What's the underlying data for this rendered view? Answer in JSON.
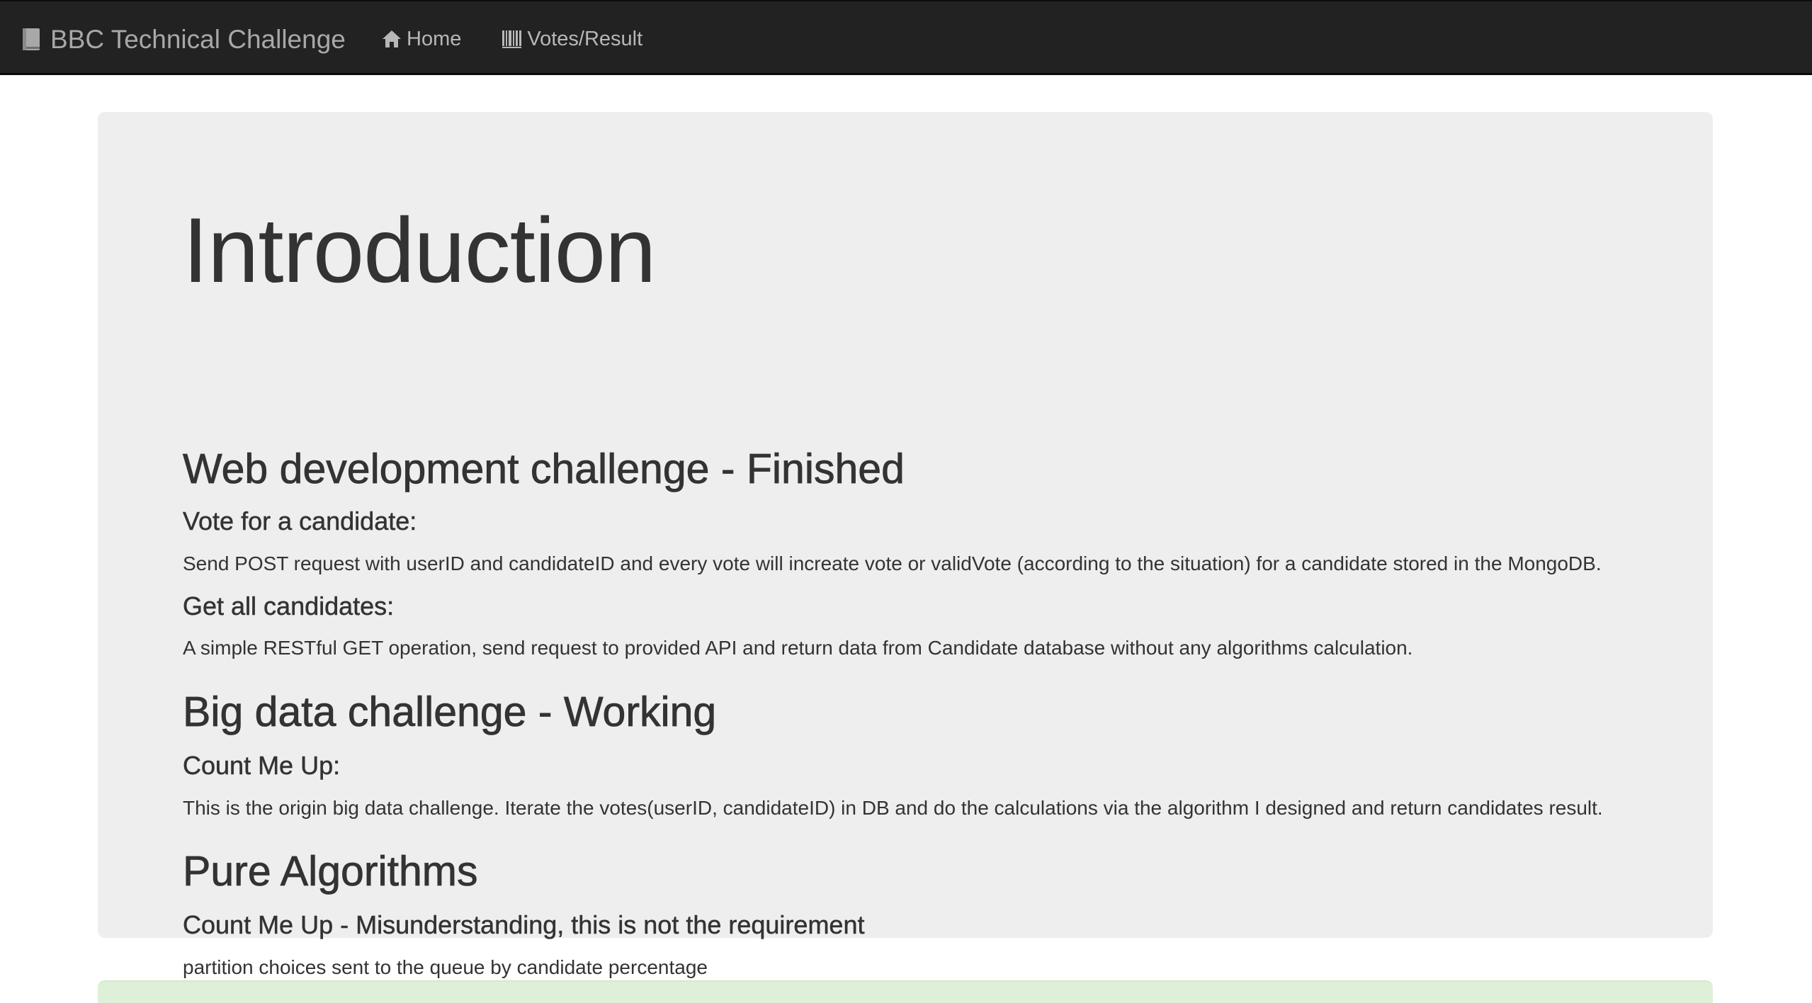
{
  "navbar": {
    "brand": "BBC Technical Challenge",
    "brand_icon": "book-icon",
    "items": [
      {
        "label": "Home",
        "icon": "home-icon"
      },
      {
        "label": "Votes/Result",
        "icon": "barcode-icon"
      }
    ]
  },
  "jumbotron": {
    "title": "Introduction",
    "sections": {
      "web": {
        "heading": "Web development challenge - Finished",
        "vote_heading": "Vote for a candidate:",
        "vote_text": "Send POST request with userID and candidateID and every vote will increate vote or validVote (according to the situation) for a candidate stored in the MongoDB.",
        "get_heading": "Get all candidates:",
        "get_text": "A simple RESTful GET operation, send request to provided API and return data from Candidate database without any algorithms calculation."
      },
      "big_data": {
        "heading": "Big data challenge - Working",
        "count_heading": "Count Me Up:",
        "count_text": "This is the origin big data challenge. Iterate the votes(userID, candidateID) in DB and do the calculations via the algorithm I designed and return candidates result."
      },
      "pure": {
        "heading": "Pure Algorithms",
        "count_heading": "Count Me Up - Misunderstanding, this is not the requirement",
        "count_text": "partition choices sent to the queue by candidate percentage"
      }
    }
  },
  "colors": {
    "navbar_bg": "#222222",
    "navbar_text": "#a8a8a8",
    "jumbotron_bg": "#eeeeee",
    "panel_success_bg": "#dff0d8"
  }
}
